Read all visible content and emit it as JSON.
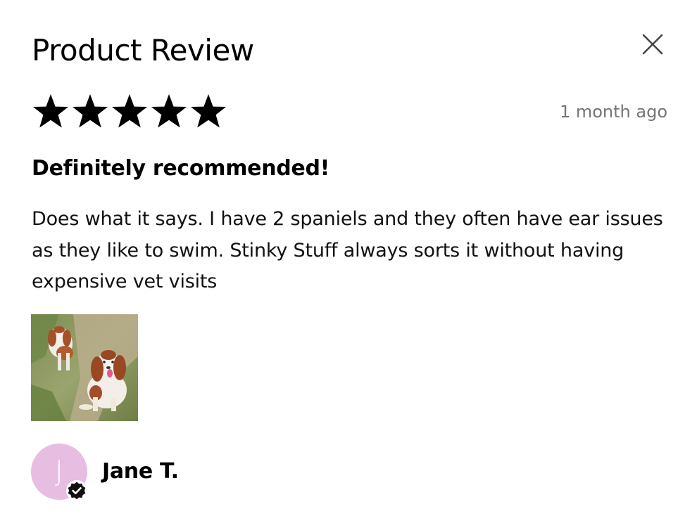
{
  "modal": {
    "title": "Product Review",
    "close_icon": "close-icon"
  },
  "review": {
    "rating": 5,
    "rating_max": 5,
    "date": "1 month ago",
    "headline": "Definitely recommended!",
    "body": "Does what it says. I have 2 spaniels and they often have ear issues as they like to swim. Stinky Stuff always sorts it without having expensive vet visits",
    "photo_icon": "review-photo-two-spaniels"
  },
  "reviewer": {
    "initial": "J",
    "name": "Jane T.",
    "avatar_color": "#e8bde2",
    "verified_icon": "verified-badge-icon"
  },
  "colors": {
    "text": "#000000",
    "muted": "#757575",
    "star": "#000000"
  }
}
